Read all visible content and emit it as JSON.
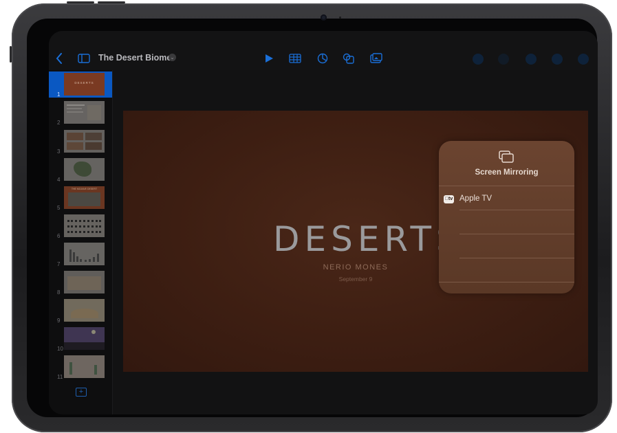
{
  "toolbar": {
    "document_title": "The Desert Biome",
    "back_icon": "chevron-left-icon",
    "sidebar_icon": "sidebar-icon",
    "play_icon": "play-icon",
    "table_icon": "table-icon",
    "chart_icon": "chart-icon",
    "shape_icon": "shape-icon",
    "media_icon": "media-icon"
  },
  "sidebar": {
    "slides": [
      {
        "number": "1",
        "thumb_label": "DESERTS"
      },
      {
        "number": "2",
        "thumb_label": ""
      },
      {
        "number": "3",
        "thumb_label": ""
      },
      {
        "number": "4",
        "thumb_label": ""
      },
      {
        "number": "5",
        "thumb_label": "THE MOJAVE DESERT"
      },
      {
        "number": "6",
        "thumb_label": ""
      },
      {
        "number": "7",
        "thumb_label": ""
      },
      {
        "number": "8",
        "thumb_label": ""
      },
      {
        "number": "9",
        "thumb_label": ""
      },
      {
        "number": "10",
        "thumb_label": ""
      },
      {
        "number": "11",
        "thumb_label": ""
      }
    ],
    "add_label": "+"
  },
  "slide": {
    "title": "DESERTS",
    "author": "NERIO MONES",
    "date": "September 9"
  },
  "screen_mirroring": {
    "title": "Screen Mirroring",
    "devices": [
      {
        "badge": "tv",
        "name": "Apple TV"
      }
    ]
  },
  "colors": {
    "accent": "#1a6fd8",
    "slide_bg": "#3d1e12",
    "panel_bg": "#6b4430"
  }
}
